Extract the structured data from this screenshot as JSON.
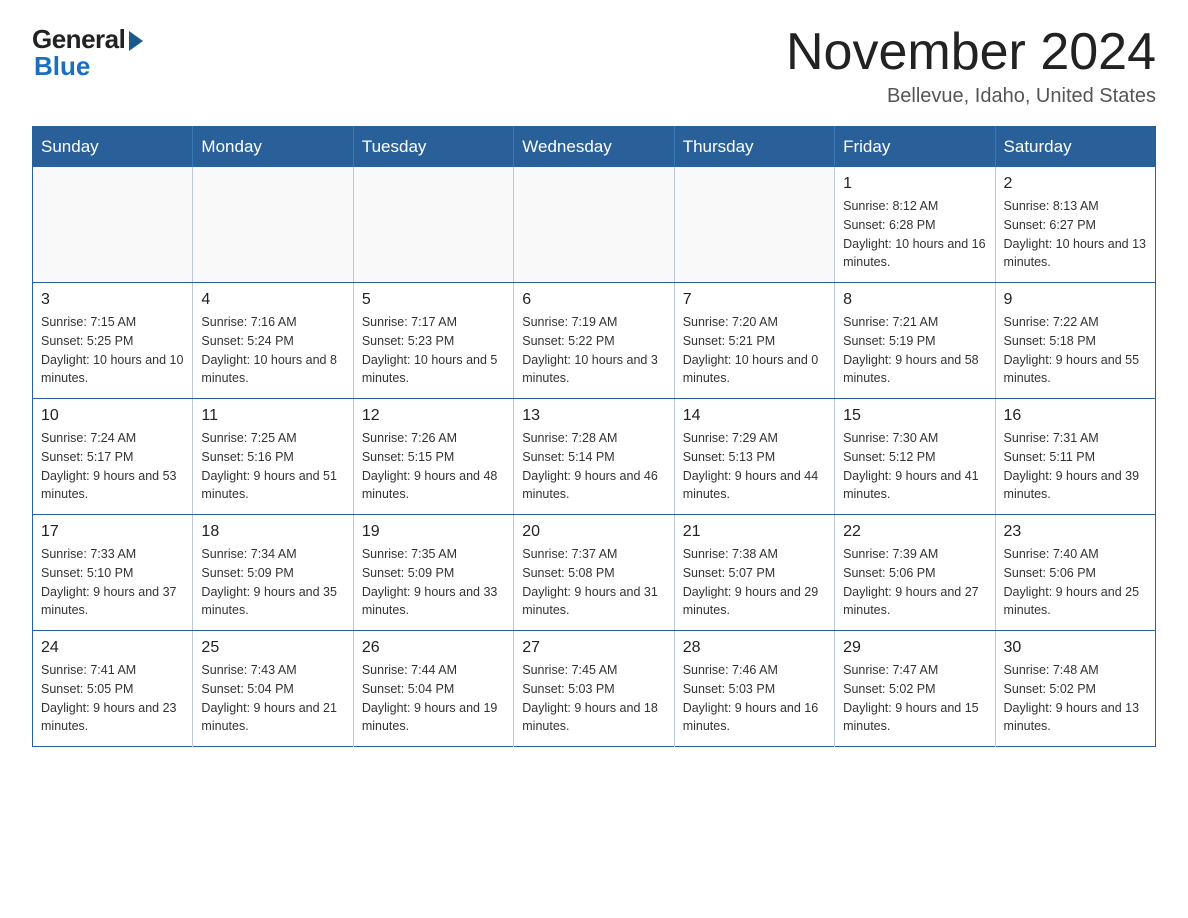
{
  "logo": {
    "general": "General",
    "blue": "Blue"
  },
  "header": {
    "month": "November 2024",
    "location": "Bellevue, Idaho, United States"
  },
  "weekdays": [
    "Sunday",
    "Monday",
    "Tuesday",
    "Wednesday",
    "Thursday",
    "Friday",
    "Saturday"
  ],
  "weeks": [
    [
      {
        "day": "",
        "info": ""
      },
      {
        "day": "",
        "info": ""
      },
      {
        "day": "",
        "info": ""
      },
      {
        "day": "",
        "info": ""
      },
      {
        "day": "",
        "info": ""
      },
      {
        "day": "1",
        "info": "Sunrise: 8:12 AM\nSunset: 6:28 PM\nDaylight: 10 hours and 16 minutes."
      },
      {
        "day": "2",
        "info": "Sunrise: 8:13 AM\nSunset: 6:27 PM\nDaylight: 10 hours and 13 minutes."
      }
    ],
    [
      {
        "day": "3",
        "info": "Sunrise: 7:15 AM\nSunset: 5:25 PM\nDaylight: 10 hours and 10 minutes."
      },
      {
        "day": "4",
        "info": "Sunrise: 7:16 AM\nSunset: 5:24 PM\nDaylight: 10 hours and 8 minutes."
      },
      {
        "day": "5",
        "info": "Sunrise: 7:17 AM\nSunset: 5:23 PM\nDaylight: 10 hours and 5 minutes."
      },
      {
        "day": "6",
        "info": "Sunrise: 7:19 AM\nSunset: 5:22 PM\nDaylight: 10 hours and 3 minutes."
      },
      {
        "day": "7",
        "info": "Sunrise: 7:20 AM\nSunset: 5:21 PM\nDaylight: 10 hours and 0 minutes."
      },
      {
        "day": "8",
        "info": "Sunrise: 7:21 AM\nSunset: 5:19 PM\nDaylight: 9 hours and 58 minutes."
      },
      {
        "day": "9",
        "info": "Sunrise: 7:22 AM\nSunset: 5:18 PM\nDaylight: 9 hours and 55 minutes."
      }
    ],
    [
      {
        "day": "10",
        "info": "Sunrise: 7:24 AM\nSunset: 5:17 PM\nDaylight: 9 hours and 53 minutes."
      },
      {
        "day": "11",
        "info": "Sunrise: 7:25 AM\nSunset: 5:16 PM\nDaylight: 9 hours and 51 minutes."
      },
      {
        "day": "12",
        "info": "Sunrise: 7:26 AM\nSunset: 5:15 PM\nDaylight: 9 hours and 48 minutes."
      },
      {
        "day": "13",
        "info": "Sunrise: 7:28 AM\nSunset: 5:14 PM\nDaylight: 9 hours and 46 minutes."
      },
      {
        "day": "14",
        "info": "Sunrise: 7:29 AM\nSunset: 5:13 PM\nDaylight: 9 hours and 44 minutes."
      },
      {
        "day": "15",
        "info": "Sunrise: 7:30 AM\nSunset: 5:12 PM\nDaylight: 9 hours and 41 minutes."
      },
      {
        "day": "16",
        "info": "Sunrise: 7:31 AM\nSunset: 5:11 PM\nDaylight: 9 hours and 39 minutes."
      }
    ],
    [
      {
        "day": "17",
        "info": "Sunrise: 7:33 AM\nSunset: 5:10 PM\nDaylight: 9 hours and 37 minutes."
      },
      {
        "day": "18",
        "info": "Sunrise: 7:34 AM\nSunset: 5:09 PM\nDaylight: 9 hours and 35 minutes."
      },
      {
        "day": "19",
        "info": "Sunrise: 7:35 AM\nSunset: 5:09 PM\nDaylight: 9 hours and 33 minutes."
      },
      {
        "day": "20",
        "info": "Sunrise: 7:37 AM\nSunset: 5:08 PM\nDaylight: 9 hours and 31 minutes."
      },
      {
        "day": "21",
        "info": "Sunrise: 7:38 AM\nSunset: 5:07 PM\nDaylight: 9 hours and 29 minutes."
      },
      {
        "day": "22",
        "info": "Sunrise: 7:39 AM\nSunset: 5:06 PM\nDaylight: 9 hours and 27 minutes."
      },
      {
        "day": "23",
        "info": "Sunrise: 7:40 AM\nSunset: 5:06 PM\nDaylight: 9 hours and 25 minutes."
      }
    ],
    [
      {
        "day": "24",
        "info": "Sunrise: 7:41 AM\nSunset: 5:05 PM\nDaylight: 9 hours and 23 minutes."
      },
      {
        "day": "25",
        "info": "Sunrise: 7:43 AM\nSunset: 5:04 PM\nDaylight: 9 hours and 21 minutes."
      },
      {
        "day": "26",
        "info": "Sunrise: 7:44 AM\nSunset: 5:04 PM\nDaylight: 9 hours and 19 minutes."
      },
      {
        "day": "27",
        "info": "Sunrise: 7:45 AM\nSunset: 5:03 PM\nDaylight: 9 hours and 18 minutes."
      },
      {
        "day": "28",
        "info": "Sunrise: 7:46 AM\nSunset: 5:03 PM\nDaylight: 9 hours and 16 minutes."
      },
      {
        "day": "29",
        "info": "Sunrise: 7:47 AM\nSunset: 5:02 PM\nDaylight: 9 hours and 15 minutes."
      },
      {
        "day": "30",
        "info": "Sunrise: 7:48 AM\nSunset: 5:02 PM\nDaylight: 9 hours and 13 minutes."
      }
    ]
  ]
}
